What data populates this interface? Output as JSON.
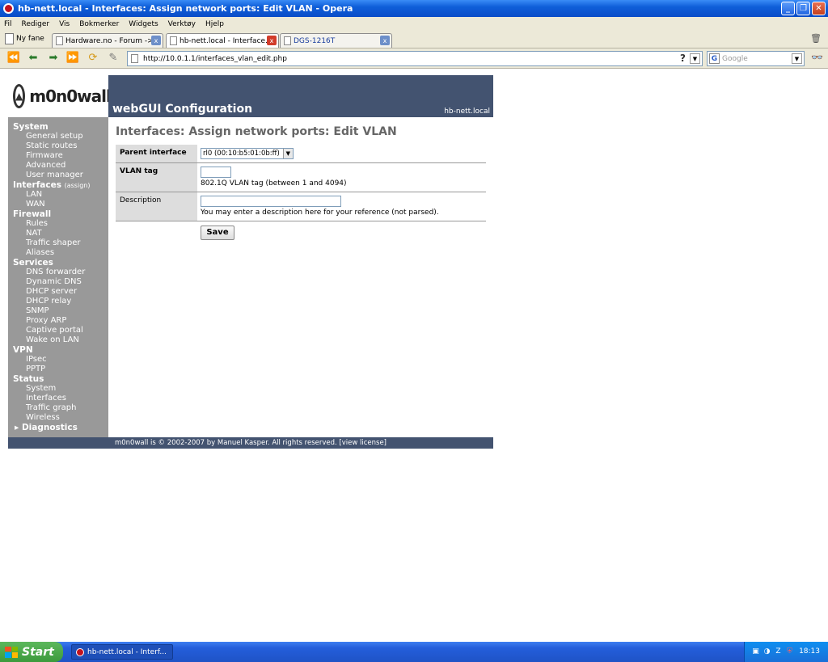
{
  "window": {
    "title": "hb-nett.local - Interfaces: Assign network ports: Edit VLAN - Opera",
    "minimize": "_",
    "maximize": "❐",
    "close": "✕"
  },
  "menu": [
    "Fil",
    "Rediger",
    "Vis",
    "Bokmerker",
    "Widgets",
    "Verktøy",
    "Hjelp"
  ],
  "tabs": {
    "new_tab": "Ny fane",
    "items": [
      {
        "label": "Hardware.no - Forum ->..."
      },
      {
        "label": "hb-nett.local - Interface..."
      },
      {
        "label": "DGS-1216T"
      }
    ]
  },
  "address": {
    "url": "http://10.0.1.1/interfaces_vlan_edit.php",
    "help_glyph": "?",
    "search_placeholder": "Google",
    "search_engine_glyph": "G"
  },
  "monowall": {
    "logo_text": "m0n0wall",
    "header": "webGUI Configuration",
    "host": "hb-nett.local",
    "nav": [
      {
        "section": "System",
        "items": [
          "General setup",
          "Static routes",
          "Firmware",
          "Advanced",
          "User manager"
        ]
      },
      {
        "section": "Interfaces",
        "extra": "(assign)",
        "items": [
          "LAN",
          "WAN"
        ]
      },
      {
        "section": "Firewall",
        "items": [
          "Rules",
          "NAT",
          "Traffic shaper",
          "Aliases"
        ]
      },
      {
        "section": "Services",
        "items": [
          "DNS forwarder",
          "Dynamic DNS",
          "DHCP server",
          "DHCP relay",
          "SNMP",
          "Proxy ARP",
          "Captive portal",
          "Wake on LAN"
        ]
      },
      {
        "section": "VPN",
        "items": [
          "IPsec",
          "PPTP"
        ]
      },
      {
        "section": "Status",
        "items": [
          "System",
          "Interfaces",
          "Traffic graph",
          "Wireless"
        ]
      }
    ],
    "diagnostics": "Diagnostics",
    "page_title": "Interfaces: Assign network ports: Edit VLAN",
    "form": {
      "parent_label": "Parent interface",
      "parent_value": "rl0 (00:10:b5:01:0b:ff)",
      "vlan_label": "VLAN tag",
      "vlan_value": "",
      "vlan_help": "802.1Q VLAN tag (between 1 and 4094)",
      "desc_label": "Description",
      "desc_value": "",
      "desc_help": "You may enter a description here for your reference (not parsed).",
      "save": "Save"
    },
    "footer": "m0n0wall is © 2002-2007 by Manuel Kasper. All rights reserved.  [view license]"
  },
  "taskbar": {
    "start": "Start",
    "task": "hb-nett.local - Interf...",
    "clock": "18:13"
  }
}
